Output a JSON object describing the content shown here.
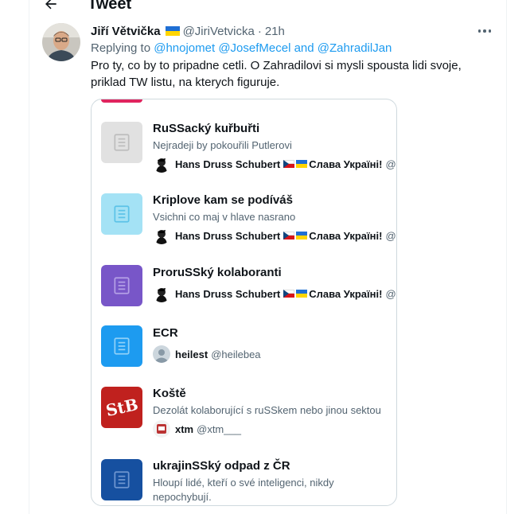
{
  "header": {
    "title": "Tweet"
  },
  "tweet": {
    "author_name": "Jiří Větvička",
    "author_handle": "@JiriVetvicka",
    "separator": "·",
    "time": "21h",
    "reply_prefix": "Replying to",
    "reply_handles": [
      "@hnojomet",
      "@JosefMecel",
      "and",
      "@ZahradilJan"
    ],
    "text": "Pro ty, co by to pripadne cetli. O Zahradilovi si mysli spousta lidi svoje, priklad TW listu, na kterych figuruje."
  },
  "lists": [
    {
      "title": "RuSSacký kuřbuřti",
      "description": "Nejradeji by pokouřili Putlerovi",
      "owner_name": "Hans Druss Schubert",
      "owner_suffix": "Слава Україні!",
      "owner_handle": "@J...",
      "thumb_color": "#e1e1e1",
      "icon_color": "#bdbdbd"
    },
    {
      "title": "Kriplove kam se podíváš",
      "description": "Vsichni co maj v hlave nasrano",
      "owner_name": "Hans Druss Schubert",
      "owner_suffix": "Слава Україні!",
      "owner_handle": "@J...",
      "thumb_color": "#a4e2f5",
      "icon_color": "#5cc3e8"
    },
    {
      "title": "ProruSSký kolaboranti",
      "owner_name": "Hans Druss Schubert",
      "owner_suffix": "Слава Україні!",
      "owner_handle": "@J...",
      "thumb_color": "#7856c8",
      "icon_color": "#b4a0e6"
    },
    {
      "title": "ECR",
      "owner_name": "heilest",
      "owner_handle": "@heilebea",
      "thumb_color": "#1d9bf0",
      "icon_color": "#8fd0f8"
    },
    {
      "title": "Koště",
      "description": "Dezolát kolaborující s ruSSkem nebo jinou sektou",
      "owner_name": "xtm",
      "owner_handle": "@xtm___",
      "thumb_color": "#c0211e",
      "thumb_text": "StB"
    },
    {
      "title": "ukrajinSSký odpad z ČR",
      "description": "Hloupí lidé, kteří o své inteligenci, nikdy nepochybují.",
      "thumb_color": "#1650a0",
      "icon_color": "#6f96d0"
    }
  ]
}
